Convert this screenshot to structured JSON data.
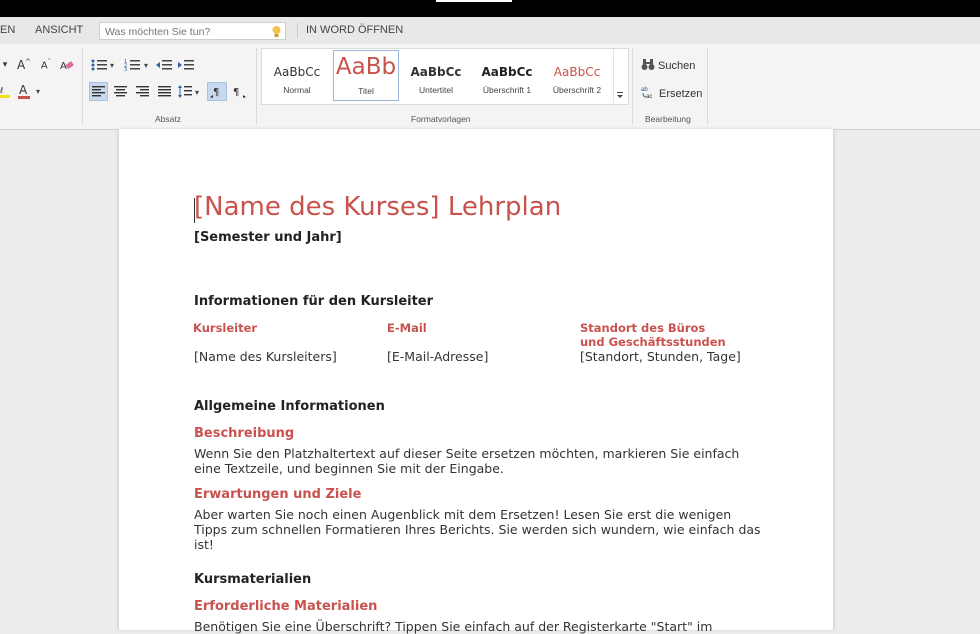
{
  "menubar": {
    "tab_partial": "EN",
    "tab_view": "ANSICHT",
    "tell_me_placeholder": "Was möchten Sie tun?",
    "open_in_word": "IN WORD ÖFFNEN"
  },
  "ribbon": {
    "groups": {
      "paragraph": "Absatz",
      "styles": "Formatvorlagen",
      "editing": "Bearbeitung"
    },
    "styles": [
      {
        "preview": "AaBbCc",
        "name": "Normal"
      },
      {
        "preview": "AaBb",
        "name": "Titel"
      },
      {
        "preview": "AaBbCc",
        "name": "Untertitel"
      },
      {
        "preview": "AaBbCc",
        "name": "Überschrift 1"
      },
      {
        "preview": "AaBbCc",
        "name": "Überschrift 2"
      }
    ],
    "editing": {
      "find": "Suchen",
      "replace": "Ersetzen"
    }
  },
  "document": {
    "title": "[Name des Kurses] Lehrplan",
    "subtitle": "[Semester und Jahr]",
    "section_instructor": "Informationen für den Kursleiter",
    "col_instructor_label": "Kursleiter",
    "col_email_label": "E-Mail",
    "col_office_label": "Standort des Büros und Geschäftsstunden",
    "col_instructor_value": "[Name des Kursleiters]",
    "col_email_value": "[E-Mail-Adresse]",
    "col_office_value": "[Standort, Stunden, Tage]",
    "section_general": "Allgemeine Informationen",
    "description_heading": "Beschreibung",
    "description_text": "Wenn Sie den Platzhaltertext auf dieser Seite ersetzen möchten, markieren Sie einfach eine Textzeile, und beginnen Sie mit der Eingabe.",
    "expectations_heading": "Erwartungen und Ziele",
    "expectations_text": "Aber warten Sie noch einen Augenblick mit dem Ersetzen! Lesen Sie erst die wenigen Tipps zum schnellen Formatieren Ihres Berichts. Sie werden sich wundern, wie einfach das ist!",
    "section_materials": "Kursmaterialien",
    "required_heading": "Erforderliche Materialien",
    "required_text": "Benötigen Sie eine Überschrift? Tippen Sie einfach auf der Registerkarte \"Start\" im"
  },
  "colors": {
    "accent": "#c9524e",
    "ribbon_bg": "#f4f4f4",
    "active_button": "#c8d9ee"
  }
}
